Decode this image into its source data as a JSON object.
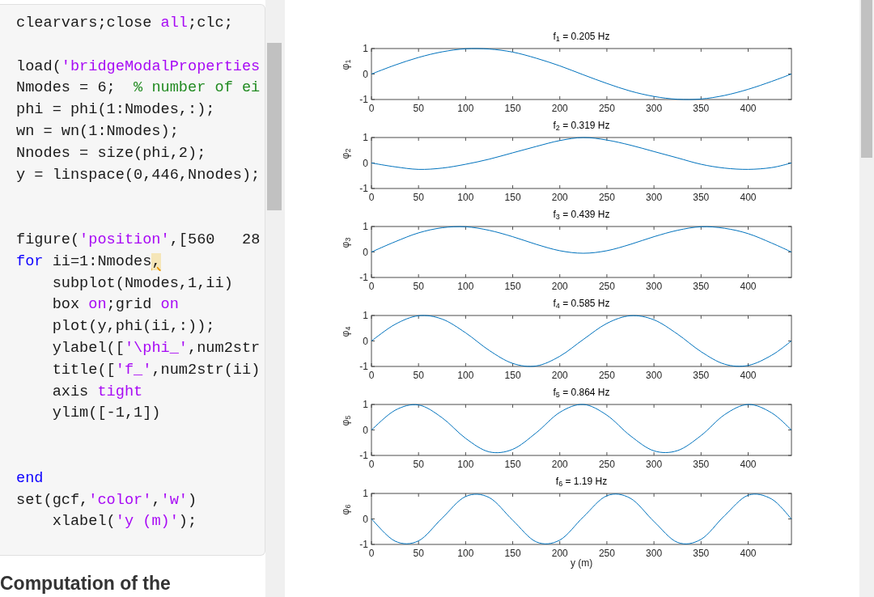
{
  "code_lines": [
    {
      "kind": "code",
      "segments": [
        {
          "text": "clearvars;close ",
          "kind": "plain"
        },
        {
          "text": "all",
          "kind": "string"
        },
        {
          "text": ";clc;",
          "kind": "plain"
        }
      ]
    },
    {
      "kind": "blank"
    },
    {
      "kind": "code",
      "segments": [
        {
          "text": "load(",
          "kind": "plain"
        },
        {
          "text": "'bridgeModalProperties",
          "kind": "string"
        }
      ]
    },
    {
      "kind": "code",
      "segments": [
        {
          "text": "Nmodes = 6;  ",
          "kind": "plain"
        },
        {
          "text": "% number of ei",
          "kind": "comment"
        }
      ]
    },
    {
      "kind": "code",
      "segments": [
        {
          "text": "phi = phi(1:Nmodes,:);",
          "kind": "plain"
        }
      ]
    },
    {
      "kind": "code",
      "segments": [
        {
          "text": "wn = wn(1:Nmodes);",
          "kind": "plain"
        }
      ]
    },
    {
      "kind": "code",
      "segments": [
        {
          "text": "Nnodes = size(phi,2);",
          "kind": "plain"
        }
      ]
    },
    {
      "kind": "code",
      "segments": [
        {
          "text": "y = linspace(0,446,Nnodes);",
          "kind": "plain"
        }
      ]
    },
    {
      "kind": "blank"
    },
    {
      "kind": "blank"
    },
    {
      "kind": "code",
      "segments": [
        {
          "text": "figure(",
          "kind": "plain"
        },
        {
          "text": "'position'",
          "kind": "string"
        },
        {
          "text": ",[560   28",
          "kind": "plain"
        }
      ]
    },
    {
      "kind": "code",
      "segments": [
        {
          "text": "for",
          "kind": "keyword"
        },
        {
          "text": " ii=1:Nmodes",
          "kind": "plain"
        },
        {
          "text": ",",
          "kind": "warning"
        }
      ]
    },
    {
      "kind": "code",
      "segments": [
        {
          "text": "    subplot(Nmodes,1,ii)",
          "kind": "plain"
        }
      ]
    },
    {
      "kind": "code",
      "segments": [
        {
          "text": "    box ",
          "kind": "plain"
        },
        {
          "text": "on",
          "kind": "string"
        },
        {
          "text": ";grid ",
          "kind": "plain"
        },
        {
          "text": "on",
          "kind": "string"
        }
      ]
    },
    {
      "kind": "code",
      "segments": [
        {
          "text": "    plot(y,phi(ii,:));",
          "kind": "plain"
        }
      ]
    },
    {
      "kind": "code",
      "segments": [
        {
          "text": "    ylabel([",
          "kind": "plain"
        },
        {
          "text": "'\\phi_'",
          "kind": "string"
        },
        {
          "text": ",num2str",
          "kind": "plain"
        }
      ]
    },
    {
      "kind": "code",
      "segments": [
        {
          "text": "    title([",
          "kind": "plain"
        },
        {
          "text": "'f_'",
          "kind": "string"
        },
        {
          "text": ",num2str(ii)",
          "kind": "plain"
        }
      ]
    },
    {
      "kind": "code",
      "segments": [
        {
          "text": "    axis ",
          "kind": "plain"
        },
        {
          "text": "tight",
          "kind": "string"
        }
      ]
    },
    {
      "kind": "code",
      "segments": [
        {
          "text": "    ylim([-1,1])",
          "kind": "plain"
        }
      ]
    },
    {
      "kind": "blank"
    },
    {
      "kind": "blank"
    },
    {
      "kind": "code",
      "segments": [
        {
          "text": "end",
          "kind": "keyword"
        }
      ]
    },
    {
      "kind": "code",
      "segments": [
        {
          "text": "set(gcf,",
          "kind": "plain"
        },
        {
          "text": "'color'",
          "kind": "string"
        },
        {
          "text": ",",
          "kind": "plain"
        },
        {
          "text": "'w'",
          "kind": "string"
        },
        {
          "text": ")",
          "kind": "plain"
        }
      ]
    },
    {
      "kind": "code",
      "segments": [
        {
          "text": "    xlabel(",
          "kind": "plain"
        },
        {
          "text": "'y (m)'",
          "kind": "string"
        },
        {
          "text": ");",
          "kind": "plain"
        }
      ]
    }
  ],
  "section_heading": "Computation of the",
  "figure": {
    "subplots": [
      {
        "chart_data": {
          "type": "line",
          "title": "f$_{1}$ = 0.205 Hz",
          "ylabel": "φ$_{1}$",
          "x": [
            0,
            25,
            50,
            75,
            100,
            125,
            150,
            175,
            200,
            225,
            250,
            275,
            300,
            325,
            350,
            375,
            400,
            425,
            446
          ],
          "series": [
            {
              "color": "#0072bd",
              "values": [
                0,
                0.35,
                0.65,
                0.87,
                0.99,
                0.98,
                0.86,
                0.62,
                0.32,
                -0.03,
                -0.37,
                -0.67,
                -0.88,
                -0.99,
                -0.98,
                -0.84,
                -0.6,
                -0.29,
                0
              ]
            }
          ],
          "xlim": [
            0,
            446
          ],
          "ylim": [
            -1,
            1
          ],
          "xticks": [
            0,
            50,
            100,
            150,
            200,
            250,
            300,
            350,
            400
          ],
          "yticks": [
            -1,
            0,
            1
          ]
        }
      },
      {
        "chart_data": {
          "type": "line",
          "title": "f$_{2}$ = 0.319 Hz",
          "ylabel": "φ$_{2}$",
          "x": [
            0,
            25,
            50,
            75,
            100,
            125,
            150,
            175,
            200,
            225,
            250,
            275,
            300,
            325,
            350,
            375,
            400,
            425,
            446
          ],
          "series": [
            {
              "color": "#0072bd",
              "values": [
                0,
                -0.15,
                -0.25,
                -0.2,
                -0.05,
                0.15,
                0.4,
                0.65,
                0.88,
                1,
                0.9,
                0.7,
                0.45,
                0.2,
                -0.05,
                -0.2,
                -0.25,
                -0.18,
                0
              ]
            }
          ],
          "xlim": [
            0,
            446
          ],
          "ylim": [
            -1,
            1
          ],
          "xticks": [
            0,
            50,
            100,
            150,
            200,
            250,
            300,
            350,
            400
          ],
          "yticks": [
            -1,
            0,
            1
          ]
        }
      },
      {
        "chart_data": {
          "type": "line",
          "title": "f$_{3}$ = 0.439 Hz",
          "ylabel": "φ$_{3}$",
          "x": [
            0,
            25,
            50,
            75,
            100,
            125,
            150,
            175,
            200,
            225,
            250,
            275,
            300,
            325,
            350,
            375,
            400,
            425,
            446
          ],
          "series": [
            {
              "color": "#0072bd",
              "values": [
                0,
                0.4,
                0.75,
                0.95,
                0.99,
                0.85,
                0.6,
                0.3,
                0.05,
                -0.05,
                0.05,
                0.3,
                0.6,
                0.85,
                0.99,
                0.93,
                0.72,
                0.35,
                0
              ]
            }
          ],
          "xlim": [
            0,
            446
          ],
          "ylim": [
            -1,
            1
          ],
          "xticks": [
            0,
            50,
            100,
            150,
            200,
            250,
            300,
            350,
            400
          ],
          "yticks": [
            -1,
            0,
            1
          ]
        }
      },
      {
        "chart_data": {
          "type": "line",
          "title": "f$_{4}$ = 0.585 Hz",
          "ylabel": "φ$_{4}$",
          "x": [
            0,
            25,
            50,
            75,
            100,
            125,
            150,
            175,
            200,
            225,
            250,
            275,
            300,
            325,
            350,
            375,
            400,
            425,
            446
          ],
          "series": [
            {
              "color": "#0072bd",
              "values": [
                0,
                0.65,
                0.99,
                0.86,
                0.32,
                -0.37,
                -0.88,
                -0.98,
                -0.6,
                0.06,
                0.69,
                0.99,
                0.83,
                0.27,
                -0.42,
                -0.91,
                -0.96,
                -0.56,
                0
              ]
            }
          ],
          "xlim": [
            0,
            446
          ],
          "ylim": [
            -1,
            1
          ],
          "xticks": [
            0,
            50,
            100,
            150,
            200,
            250,
            300,
            350,
            400
          ],
          "yticks": [
            -1,
            0,
            1
          ]
        }
      },
      {
        "chart_data": {
          "type": "line",
          "title": "f$_{5}$ = 0.864 Hz",
          "ylabel": "φ$_{5}$",
          "x": [
            0,
            25,
            50,
            75,
            100,
            125,
            150,
            175,
            200,
            225,
            250,
            275,
            300,
            325,
            350,
            375,
            400,
            425,
            446
          ],
          "series": [
            {
              "color": "#0072bd",
              "values": [
                0,
                0.77,
                0.98,
                0.48,
                -0.33,
                -0.86,
                -0.76,
                -0.11,
                0.69,
                1,
                0.58,
                -0.23,
                -0.82,
                -0.81,
                -0.22,
                0.6,
                1,
                0.67,
                0
              ]
            }
          ],
          "xlim": [
            0,
            446
          ],
          "ylim": [
            -1,
            1
          ],
          "xticks": [
            0,
            50,
            100,
            150,
            200,
            250,
            300,
            350,
            400
          ],
          "yticks": [
            -1,
            0,
            1
          ]
        }
      },
      {
        "chart_data": {
          "type": "line",
          "title": "f$_{6}$ = 1.19 Hz",
          "ylabel": "φ$_{6}$",
          "xlabel": "y (m)",
          "x": [
            0,
            25,
            50,
            75,
            100,
            125,
            150,
            175,
            200,
            225,
            250,
            275,
            300,
            325,
            350,
            375,
            400,
            425,
            446
          ],
          "series": [
            {
              "color": "#0072bd",
              "values": [
                0,
                -0.87,
                -0.86,
                0.03,
                0.88,
                0.84,
                -0.05,
                -0.9,
                -0.83,
                0.08,
                0.91,
                0.81,
                -0.1,
                -0.92,
                -0.8,
                0.13,
                0.93,
                0.78,
                0
              ]
            }
          ],
          "xlim": [
            0,
            446
          ],
          "ylim": [
            -1,
            1
          ],
          "xticks": [
            0,
            50,
            100,
            150,
            200,
            250,
            300,
            350,
            400
          ],
          "yticks": [
            -1,
            0,
            1
          ]
        }
      }
    ]
  }
}
